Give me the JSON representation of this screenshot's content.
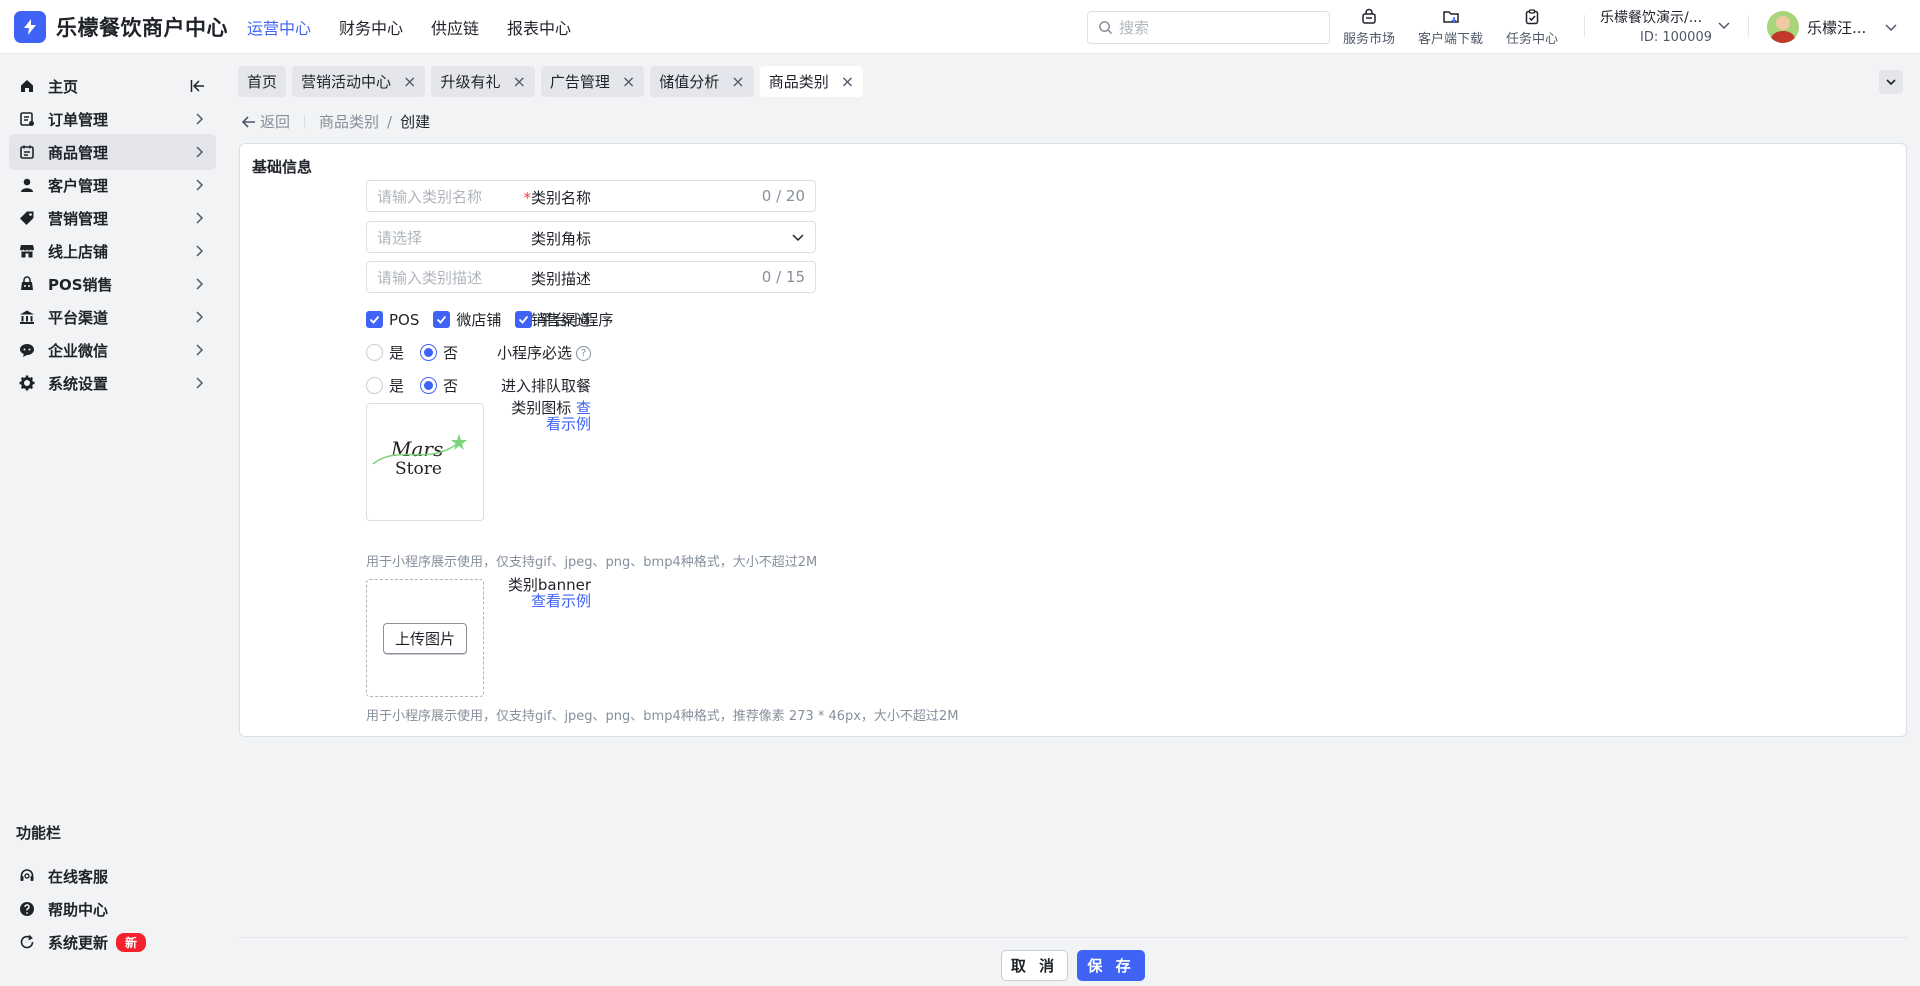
{
  "brand": {
    "title": "乐檬餐饮商户中心",
    "color": "#3f63f5"
  },
  "topnav": [
    {
      "label": "运营中心",
      "active": true
    },
    {
      "label": "财务中心"
    },
    {
      "label": "供应链"
    },
    {
      "label": "报表中心"
    }
  ],
  "search": {
    "placeholder": "搜索"
  },
  "tools": [
    {
      "label": "服务市场",
      "icon": "bag-icon"
    },
    {
      "label": "客户端下载",
      "icon": "folder-download-icon"
    },
    {
      "label": "任务中心",
      "icon": "clipboard-icon"
    }
  ],
  "merchant": {
    "name": "乐檬餐饮演示/...",
    "id": "ID: 100009"
  },
  "user": {
    "name": "乐檬汪..."
  },
  "sidebar": {
    "items": [
      {
        "label": "主页",
        "icon": "home-icon"
      },
      {
        "label": "订单管理",
        "icon": "order-icon"
      },
      {
        "label": "商品管理",
        "icon": "goods-icon",
        "active": true
      },
      {
        "label": "客户管理",
        "icon": "user-icon"
      },
      {
        "label": "营销管理",
        "icon": "tag-icon"
      },
      {
        "label": "线上店铺",
        "icon": "store-icon"
      },
      {
        "label": "POS销售",
        "icon": "pos-icon"
      },
      {
        "label": "平台渠道",
        "icon": "bank-icon"
      },
      {
        "label": "企业微信",
        "icon": "chat-icon"
      },
      {
        "label": "系统设置",
        "icon": "gear-icon"
      }
    ],
    "func_title": "功能栏",
    "func_items": [
      {
        "label": "在线客服",
        "icon": "headset-icon"
      },
      {
        "label": "帮助中心",
        "icon": "help-icon"
      },
      {
        "label": "系统更新",
        "icon": "refresh-icon",
        "badge": "新"
      }
    ]
  },
  "tabs": [
    {
      "label": "首页",
      "closable": false
    },
    {
      "label": "营销活动中心",
      "closable": true
    },
    {
      "label": "升级有礼",
      "closable": true
    },
    {
      "label": "广告管理",
      "closable": true
    },
    {
      "label": "储值分析",
      "closable": true
    },
    {
      "label": "商品类别",
      "closable": true,
      "active": true
    }
  ],
  "breadcrumb": {
    "back": "返回",
    "parent": "商品类别",
    "current": "创建"
  },
  "form": {
    "section_title": "基础信息",
    "name": {
      "label": "类别名称",
      "placeholder": "请输入类别名称",
      "counter": "0 / 20"
    },
    "corner": {
      "label": "类别角标",
      "placeholder": "请选择"
    },
    "desc": {
      "label": "类别描述",
      "placeholder": "请输入类别描述",
      "counter": "0 / 15"
    },
    "channels": {
      "label": "销售渠道",
      "options": [
        "POS",
        "微店铺",
        "平台小程序"
      ]
    },
    "required_mini": {
      "label": "小程序必选",
      "options": [
        "是",
        "否"
      ],
      "selected": "否"
    },
    "queue": {
      "label": "进入排队取餐",
      "options": [
        "是",
        "否"
      ],
      "selected": "否"
    },
    "icon": {
      "label": "类别图标",
      "link": "查看示例",
      "hint": "用于小程序展示使用，仅支持gif、jpeg、png、bmp4种格式，大小不超过2M",
      "logo_text": "Mars Store"
    },
    "banner": {
      "label": "类别banner",
      "link": "查看示例",
      "upload": "上传图片",
      "hint": "用于小程序展示使用，仅支持gif、jpeg、png、bmp4种格式，推荐像素 273 * 46px，大小不超过2M"
    }
  },
  "footer": {
    "cancel": "取 消",
    "save": "保 存"
  }
}
